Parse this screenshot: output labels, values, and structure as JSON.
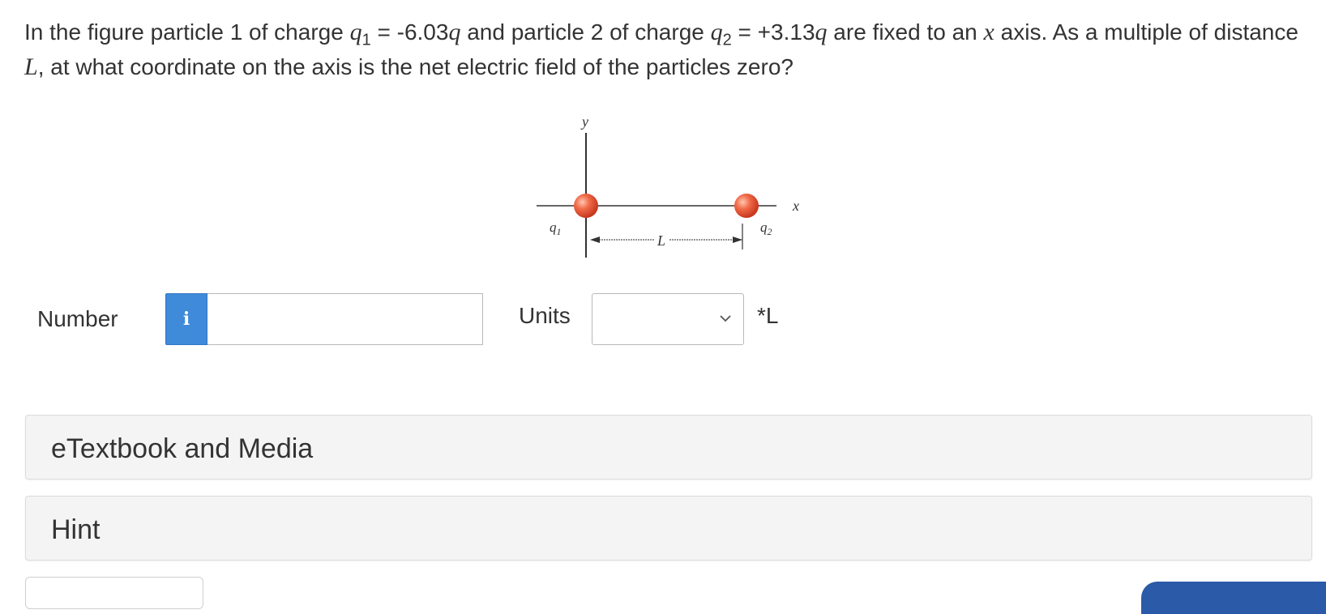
{
  "question": {
    "part1": "In the figure particle 1 of charge ",
    "q1_symbol": "q",
    "q1_sub": "1",
    "q1_value": " = -6.03",
    "q1_unit": "q",
    "part2": " and particle 2 of charge ",
    "q2_symbol": "q",
    "q2_sub": "2",
    "q2_value": " = +3.13",
    "q2_unit": "q",
    "part3": " are fixed to an ",
    "x_var": "x",
    "part4": " axis. As a multiple of distance ",
    "L_var": "L",
    "part5": ", at what coordinate on the axis is the net electric field of the particles zero?"
  },
  "figure": {
    "y_axis_label": "y",
    "x_axis_label": "x",
    "q1_label": "q",
    "q1_label_sub": "1",
    "q2_label": "q",
    "q2_label_sub": "2",
    "distance_label": "L",
    "particle_color": "#e8553a"
  },
  "answer": {
    "number_label": "Number",
    "info_icon": "i",
    "number_value": "",
    "units_label": "Units",
    "units_selected": "",
    "unit_suffix": "*L"
  },
  "panels": {
    "etextbook": "eTextbook and Media",
    "hint": "Hint"
  },
  "colors": {
    "info_button": "#3f8ad9",
    "panel_bg": "#f4f4f4",
    "primary_button": "#2a5aa8"
  }
}
